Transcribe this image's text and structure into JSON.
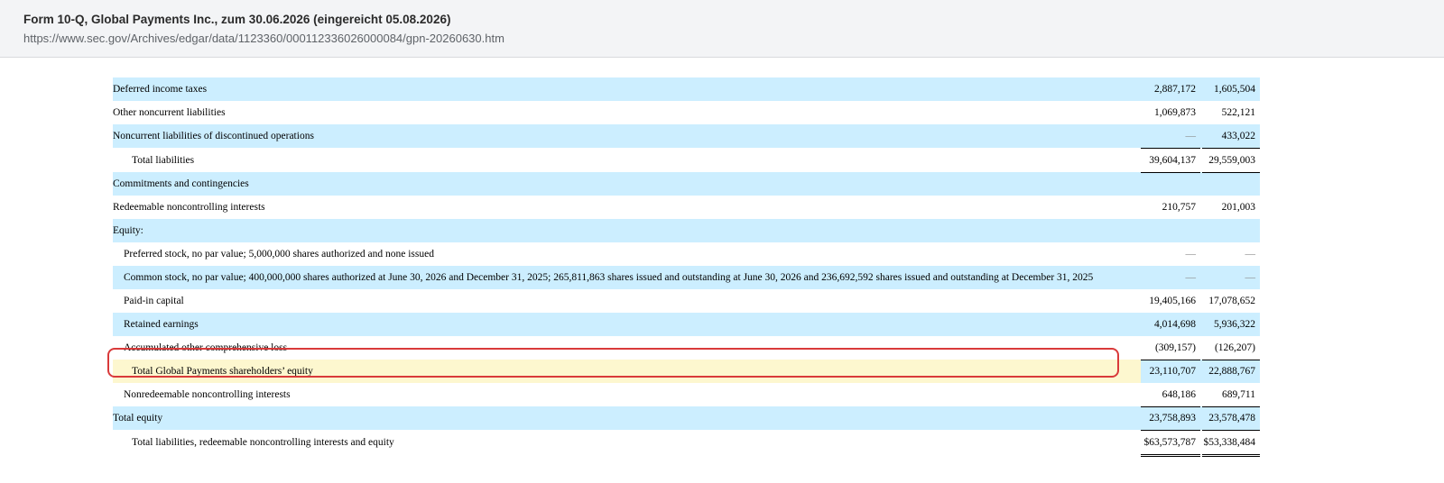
{
  "header": {
    "title": "Form 10-Q, Global Payments Inc., zum 30.06.2026 (eingereicht 05.08.2026)",
    "url": "https://www.sec.gov/Archives/edgar/data/1123360/000112336026000084/gpn-20260630.htm"
  },
  "rows": [
    {
      "label": "Deferred income taxes",
      "v1": "2,887,172",
      "v2": "1,605,504"
    },
    {
      "label": "Other noncurrent liabilities",
      "v1": "1,069,873",
      "v2": "522,121"
    },
    {
      "label": "Noncurrent liabilities of discontinued operations",
      "v1": "—",
      "v2": "433,022"
    },
    {
      "label": "Total liabilities",
      "v1": "39,604,137",
      "v2": "29,559,003"
    },
    {
      "label": "Commitments and contingencies",
      "v1": "",
      "v2": ""
    },
    {
      "label": "Redeemable noncontrolling interests",
      "v1": "210,757",
      "v2": "201,003"
    },
    {
      "label": "Equity:",
      "v1": "",
      "v2": ""
    },
    {
      "label": "Preferred stock, no par value; 5,000,000 shares authorized and none issued",
      "v1": "—",
      "v2": "—"
    },
    {
      "label": "Common stock, no par value; 400,000,000 shares authorized at June 30, 2026 and December 31, 2025; 265,811,863 shares issued and outstanding at June 30, 2026 and 236,692,592 shares issued and outstanding at December 31, 2025",
      "v1": "—",
      "v2": "—"
    },
    {
      "label": "Paid-in capital",
      "v1": "19,405,166",
      "v2": "17,078,652"
    },
    {
      "label": "Retained earnings",
      "v1": "4,014,698",
      "v2": "5,936,322"
    },
    {
      "label": "Accumulated other comprehensive loss",
      "v1": "(309,157)",
      "v2": "(126,207)"
    },
    {
      "label": "Total Global Payments shareholders’ equity",
      "v1": "23,110,707",
      "v2": "22,888,767"
    },
    {
      "label": "Nonredeemable noncontrolling interests",
      "v1": "648,186",
      "v2": "689,711"
    },
    {
      "label": "Total equity",
      "v1": "23,758,893",
      "v2": "23,578,478"
    },
    {
      "label": "Total liabilities, redeemable noncontrolling interests and equity",
      "v1": "$63,573,787",
      "v2": "$53,338,484"
    }
  ],
  "colors": {
    "row_shade": "#cceeff",
    "highlight_fill": "#fdf7cf",
    "highlight_border": "#d93a3a"
  }
}
